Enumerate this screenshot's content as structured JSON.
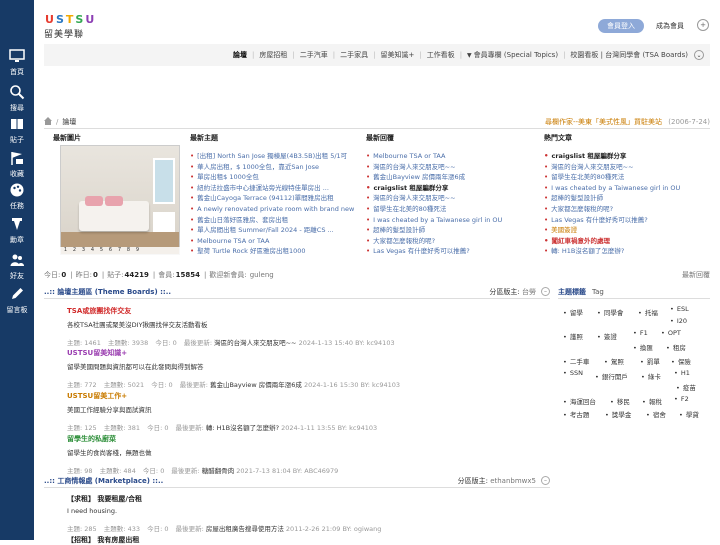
{
  "sidebar": {
    "items": [
      {
        "label": "首頁",
        "icon": "monitor-icon"
      },
      {
        "label": "搜尋",
        "icon": "search-icon"
      },
      {
        "label": "貼子",
        "icon": "book-icon"
      },
      {
        "label": "收藏",
        "icon": "flag-icon"
      },
      {
        "label": "任務",
        "icon": "palette-icon"
      },
      {
        "label": "勳章",
        "icon": "medal-icon"
      },
      {
        "label": "好友",
        "icon": "friends-icon"
      },
      {
        "label": "留言板",
        "icon": "pencil-icon"
      }
    ]
  },
  "header": {
    "logo_letters": [
      "U",
      "S",
      "T",
      "S",
      "U"
    ],
    "logo_colors": [
      "#e63b2e",
      "#2b78c2",
      "#f2a900",
      "#33a852",
      "#8c3fb4"
    ],
    "logo_cn": "留美學聯",
    "login_label": "會員登入",
    "register_label": "成為會員"
  },
  "nav": {
    "items": [
      "論壇",
      "房屋招租",
      "二手汽車",
      "二手家具",
      "留美知識+",
      "工作看板",
      "會員專欄 (Special Topics)",
      "校園看板 | 台灣同學會 (TSA Boards)"
    ],
    "current": "論壇"
  },
  "breadcrumb": {
    "current": "論壇",
    "announce": "尋欄作家--美東「美式性風」買駐美站",
    "announce_date": "(2006-7-24)"
  },
  "top": {
    "headers": {
      "pics": "最新圖片",
      "topics": "最新主題",
      "replies": "最新回覆",
      "hot": "熱門文章"
    },
    "pic_pages": [
      "1",
      "2",
      "3",
      "4",
      "5",
      "6",
      "7",
      "8",
      "9"
    ],
    "topics": [
      "[出租] North San Jose 獨棟屋(4B3.5B)出租 5/1可",
      "華人房出租，$ 1000全包，靠近San Jose",
      "單房出租$ 1000全包",
      "紐約法拉盛市中心捷運站旁光線特佳單房出 ...",
      "舊金山Cayoga Terrace (94112)單間雅房出租",
      "A newly renovated private room with brand new",
      "舊金山日落好區雅房、套房出租",
      "單人房間出租 Summer/Fall 2024 - 距離CS ...",
      "Melbourne TSA or TAA",
      "聖荷 Turtle Rock 好區雅房出租1000"
    ],
    "replies": [
      "Melbourne TSA or TAA",
      "灣區的台灣人來交朋友吧~~",
      "舊金山Bayview 房價兩年漲6成",
      "craigslist 租屋騙群分享",
      "灣區的台灣人來交朋友吧~~",
      "留學生在北美的80種死法",
      "I was cheated by a Taiwanese girl in OU",
      "超棒的髮型設計師",
      "大家都怎麼報稅的呢?",
      "Las Vegas 有什麼好秀可以推薦?"
    ],
    "hot": [
      "craigslist 租屋騙群分享",
      "灣區的台灣人來交朋友吧~~",
      "留學生在北美的80種死法",
      "I was cheated by a Taiwanese girl in OU",
      "超棒的髮型設計師",
      "大家都怎麼報稅的呢?",
      "Las Vegas 有什麼好秀可以推薦?",
      "美國簽證",
      "闖紅車禍意外的處理",
      "轉: H1B沒名額了怎麼辦?"
    ]
  },
  "stats": {
    "today_label": "今日:",
    "today": "0",
    "yesterday_label": "昨日:",
    "yesterday": "0",
    "posts_label": "貼子:",
    "posts": "44219",
    "members_label": "會員:",
    "members": "15854",
    "newmember_label": "歡迎新會員:",
    "newmember": "guleng",
    "latest_reply": "最新回覆"
  },
  "theme_section": {
    "title": "..:: 論壇主題區 (Theme Boards) ::..",
    "mods_label": "分區版主:",
    "mods": "台勞",
    "forums": [
      {
        "name": "TSA或旅團找伴交友",
        "color": "#d12a2a",
        "desc": "各校TSA社團或聚美沒DIY揪團找伴交友活動看板",
        "topics": "1461",
        "posts": "3938",
        "today": "0",
        "last": "灣區的台灣人來交朋友吧~~",
        "time": "2024-1-13 15:40",
        "by": "kc94103"
      },
      {
        "name": "USTSU留美知識+",
        "color": "#9a3db0",
        "desc": "留學美國問題與資訊都可以在此發問與得到解答",
        "topics": "772",
        "posts": "5021",
        "today": "0",
        "last": "舊金山Bayview 房價兩年漲6成",
        "time": "2024-1-16 15:30",
        "by": "kc94103"
      },
      {
        "name": "USTSU留美工作+",
        "color": "#c97b00",
        "desc": "美國工作經驗分享與面試資訊",
        "topics": "125",
        "posts": "381",
        "today": "0",
        "last": "轉: H1B沒名額了怎麼辦?",
        "time": "2024-1-11 13:55",
        "by": "kc94103"
      },
      {
        "name": "留學生的私廚菜",
        "color": "#2e8f3a",
        "desc": "留學生的食尚客棧，無題也做",
        "topics": "98",
        "posts": "484",
        "today": "0",
        "last": "糖醋翻骨肉",
        "time": "2021-7-13 81:04",
        "by": "ABC46979"
      }
    ]
  },
  "market_section": {
    "title": "..:: 工商情報處 (Marketplace) ::..",
    "mods_label": "分區版主:",
    "mods": "ethanbmwx5",
    "forums": [
      {
        "name": "【求租】 我要租屋/合租",
        "color": "#222222",
        "desc": "I need housing.",
        "topics": "285",
        "posts": "433",
        "today": "0",
        "last": "房屋出租廣告搜尋使用方法",
        "time": "2011-2-26 21:09",
        "by": "ogiwang"
      },
      {
        "name": "【招租】 我有房屋出租",
        "color": "#222222",
        "desc": "",
        "topics": "",
        "posts": "",
        "today": "",
        "last": "",
        "time": "",
        "by": ""
      }
    ],
    "labels": {
      "topics": "主題:",
      "posts": "主題數:",
      "today": "今日:",
      "last": "最後更新:",
      "by": "BY:"
    }
  },
  "tags": {
    "title": "主題標籤",
    "sub": "Tag",
    "items": [
      "留學",
      "同學會",
      "托福",
      "ESL",
      "I20",
      "護照",
      "簽證",
      "F1",
      "OPT",
      "換匯",
      "租房",
      "二手車",
      "駕照",
      "罰單",
      "保險",
      "SSN",
      "銀行開戶",
      "綠卡",
      "H1",
      "疫苗",
      "海運回台",
      "移民",
      "報稅",
      "F2",
      "考古題",
      "獎學金",
      "宿舍",
      "學貸"
    ]
  }
}
